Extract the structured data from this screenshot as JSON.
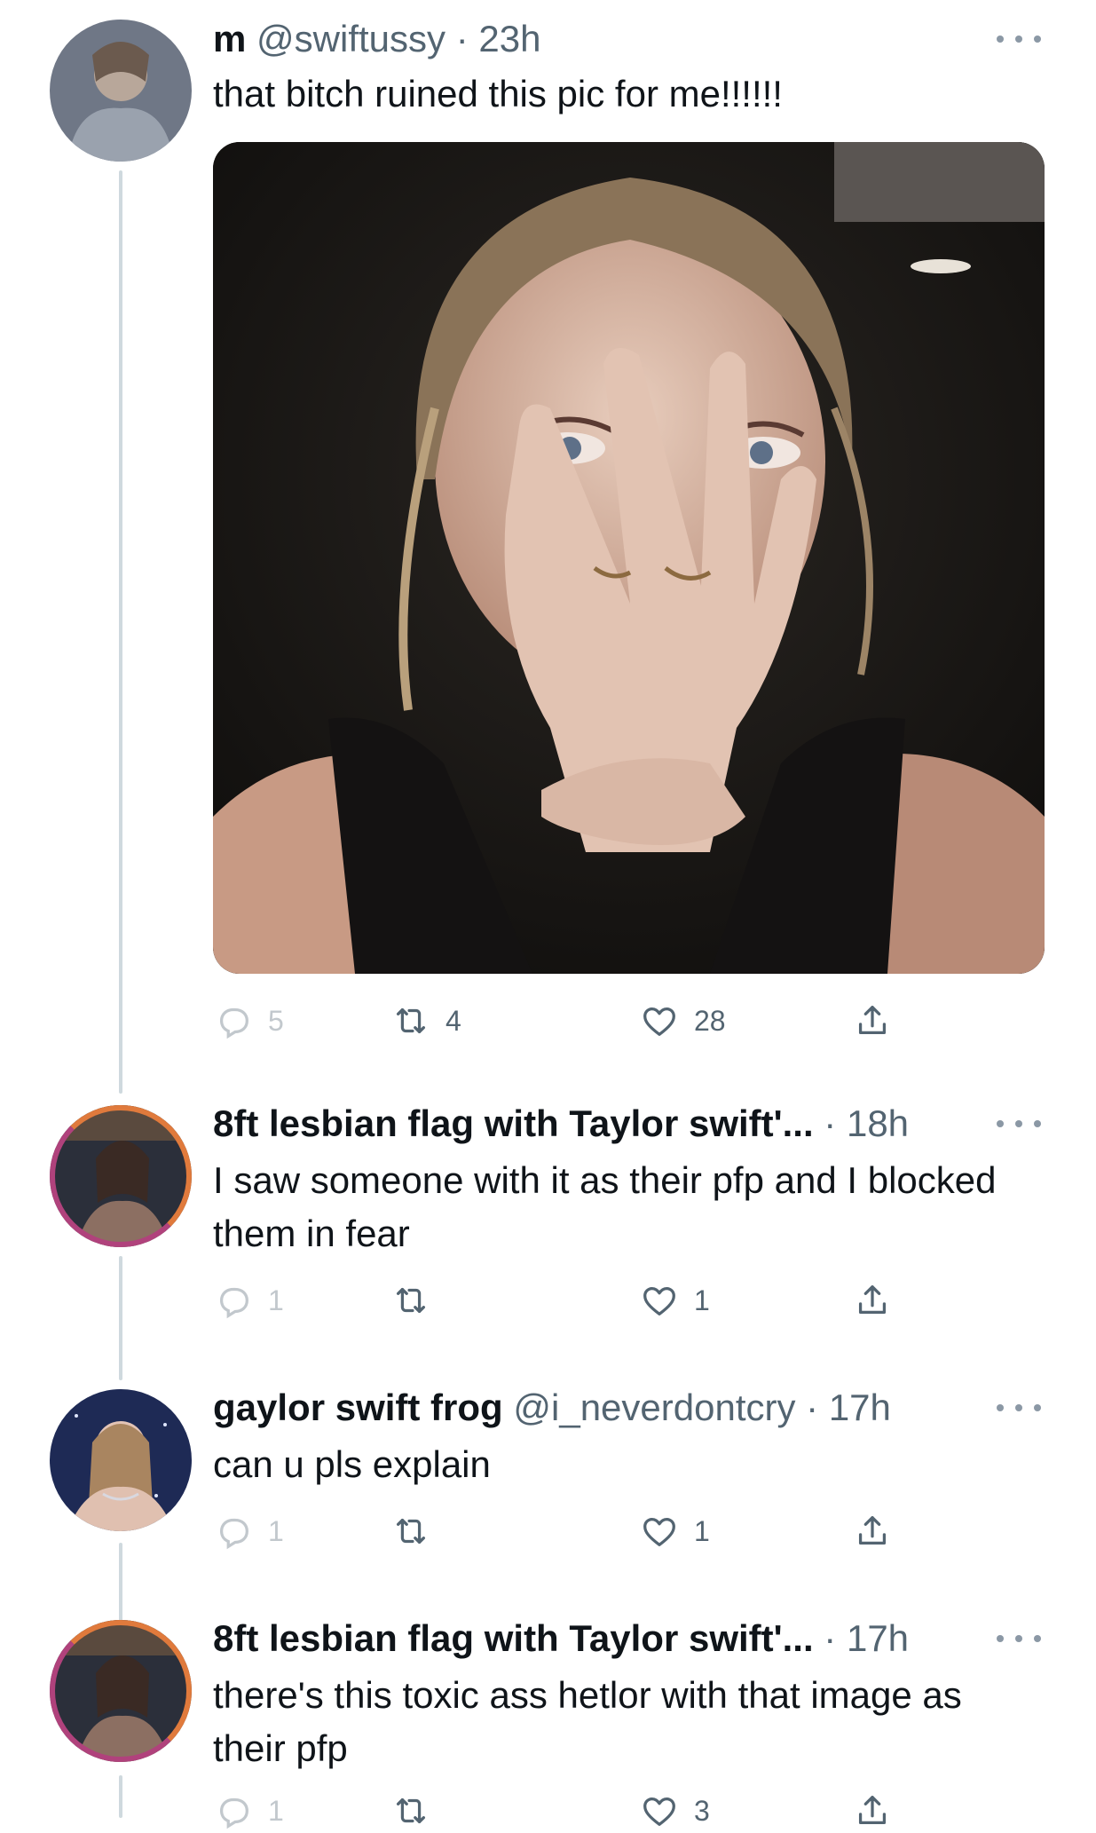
{
  "tweets": [
    {
      "display_name": "m",
      "handle": "@swiftussy",
      "time": "23h",
      "text": "that bitch ruined this pic for me!!!!!!",
      "replies": "5",
      "retweets": "4",
      "likes": "28"
    },
    {
      "display_name": "8ft lesbian flag with Taylor swift'...",
      "handle": "",
      "time": "18h",
      "text": "I saw someone with it as their pfp and I blocked them in fear",
      "replies": "1",
      "retweets": "",
      "likes": "1"
    },
    {
      "display_name": "gaylor swift frog",
      "handle": "@i_neverdontcry",
      "time": "17h",
      "text": "can u pls explain",
      "replies": "1",
      "retweets": "",
      "likes": "1"
    },
    {
      "display_name": "8ft lesbian flag with Taylor swift'...",
      "handle": "",
      "time": "17h",
      "text": "there's this toxic ass hetlor with that image as their pfp",
      "replies": "1",
      "retweets": "",
      "likes": "3"
    }
  ],
  "colors": {
    "text": "#0f1419",
    "secondary": "#536471",
    "thread_line": "#cfd9de",
    "ring_orange": "#e07a3c",
    "ring_magenta": "#b0427c"
  },
  "icons": {
    "reply": "reply-icon",
    "retweet": "retweet-icon",
    "like": "heart-icon",
    "share": "share-icon",
    "more": "more-icon"
  }
}
